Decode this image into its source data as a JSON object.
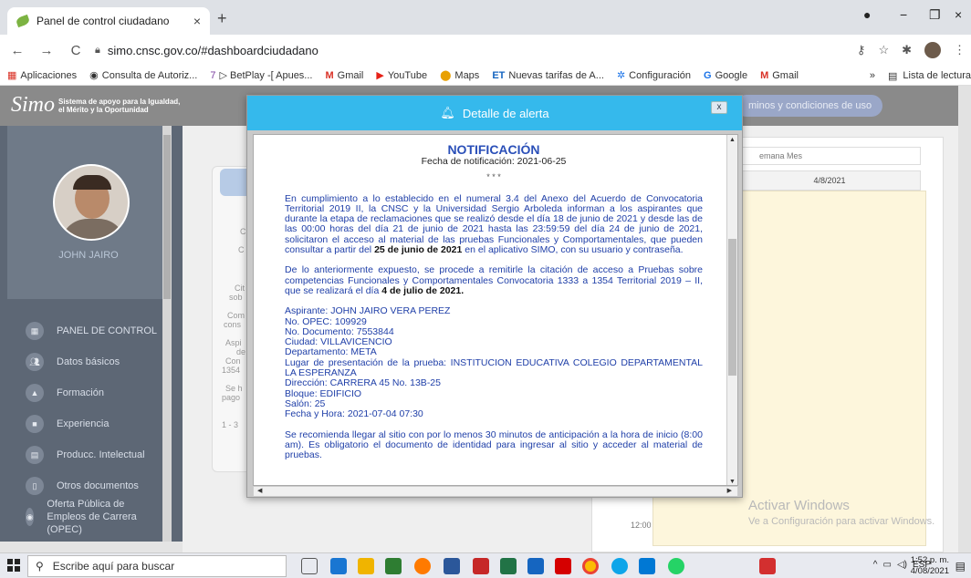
{
  "browser": {
    "tab_title": "Panel de control ciudadano",
    "tab_close": "×",
    "new_tab": "+",
    "url": "simo.cnsc.gov.co/#dashboardciudadano",
    "bookmarks": [
      {
        "label": "Aplicaciones",
        "icon": "apps-icon"
      },
      {
        "label": "Consulta de Autoriz...",
        "icon": "globe-icon"
      },
      {
        "label": "▷ BetPlay -[ Apues...",
        "icon": "betplay-icon"
      },
      {
        "label": "Gmail",
        "icon": "gmail-icon"
      },
      {
        "label": "YouTube",
        "icon": "youtube-icon"
      },
      {
        "label": "Maps",
        "icon": "maps-icon"
      },
      {
        "label": "Nuevas tarifas de A...",
        "icon": "et-icon"
      },
      {
        "label": "Configuración",
        "icon": "gear-icon"
      },
      {
        "label": "Google",
        "icon": "google-icon"
      },
      {
        "label": "Gmail",
        "icon": "gmail-icon"
      }
    ],
    "bookmarks_more": "»",
    "reading_list": "Lista de lectura"
  },
  "site": {
    "logo_big": "Simo",
    "logo_line1": "Sistema de apoyo para la Igualdad,",
    "logo_line2": "el Mérito y la Oportunidad",
    "header_pill": "minos y condiciones de uso",
    "user_name": "JOHN JAIRO",
    "menu": [
      {
        "label": "PANEL DE CONTROL",
        "icon": "dashboard-icon"
      },
      {
        "label": "Datos básicos",
        "icon": "people-icon"
      },
      {
        "label": "Formación",
        "icon": "graduation-icon"
      },
      {
        "label": "Experiencia",
        "icon": "briefcase-icon"
      },
      {
        "label": "Producc. Intelectual",
        "icon": "document-icon"
      },
      {
        "label": "Otros documentos",
        "icon": "file-icon"
      },
      {
        "label": "Oferta Pública de Empleos de Carrera (OPEC)",
        "icon": "globe-icon"
      }
    ],
    "card_fragments": [
      "C",
      "C",
      "Cit",
      "sob",
      "Com",
      "cons",
      "Aspi",
      "de",
      "Con",
      "1354",
      "Se h",
      "pago",
      "1 - 3"
    ],
    "calendar": {
      "view_labels": "emana   Mes",
      "date": "4/8/2021",
      "time": "12:00"
    },
    "watermark_title": "Activar Windows",
    "watermark_sub": "Ve a Configuración para activar Windows."
  },
  "modal": {
    "title": "Detalle de alerta",
    "close": "x",
    "heading": "NOTIFICACIÓN",
    "date_line": "Fecha de notificación: 2021-06-25",
    "stars": "* * *",
    "p1_a": "En cumplimiento a lo establecido en el numeral 3.4 del Anexo del Acuerdo de Convocatoria Territorial 2019 II, la CNSC y la Universidad Sergio Arboleda informan a los aspirantes que durante la etapa de reclamaciones que se realizó desde el día 18 de junio de 2021 y desde las de las 00:00 horas del día 21 de junio de 2021 hasta las 23:59:59 del día 24 de junio de 2021,  solicitaron el acceso al material de las pruebas Funcionales y Comportamentales, que pueden consultar a partir del ",
    "p1_bold": "25 de junio de 2021",
    "p1_b": " en el aplicativo SIMO, con su usuario y contraseña.",
    "p2_a": "De lo anteriormente expuesto, se procede a remitirle la citación de acceso a Pruebas sobre competencias Funcionales y Comportamentales Convocatoria 1333 a 1354 Territorial 2019 – II, que se realizará el día ",
    "p2_bold": "4 de julio de 2021.",
    "details": [
      "Aspirante: JOHN JAIRO VERA PEREZ",
      "No. OPEC: 109929",
      "No. Documento: 7553844",
      "Ciudad: VILLAVICENCIO",
      "Departamento: META",
      "Lugar de presentación de la prueba: INSTITUCION EDUCATIVA COLEGIO DEPARTAMENTAL LA ESPERANZA",
      "Dirección: CARRERA 45 No. 13B-25",
      "Bloque: EDIFICIO",
      "Salón: 25",
      "Fecha y Hora: 2021-07-04 07:30"
    ],
    "p3": "Se recomienda llegar al sitio con por lo menos 30 minutos de anticipación a la hora de inicio (8:00 am). Es obligatorio el documento de identidad para ingresar al sitio y acceder al material de pruebas."
  },
  "taskbar": {
    "search_placeholder": "Escribe aquí para buscar",
    "tray_lang": "ESP",
    "time": "1:52 p. m.",
    "date": "4/08/2021"
  },
  "colors": {
    "modal_header": "#35b9ec",
    "modal_text": "#1f3fa8",
    "sidebar": "#5d6775"
  }
}
